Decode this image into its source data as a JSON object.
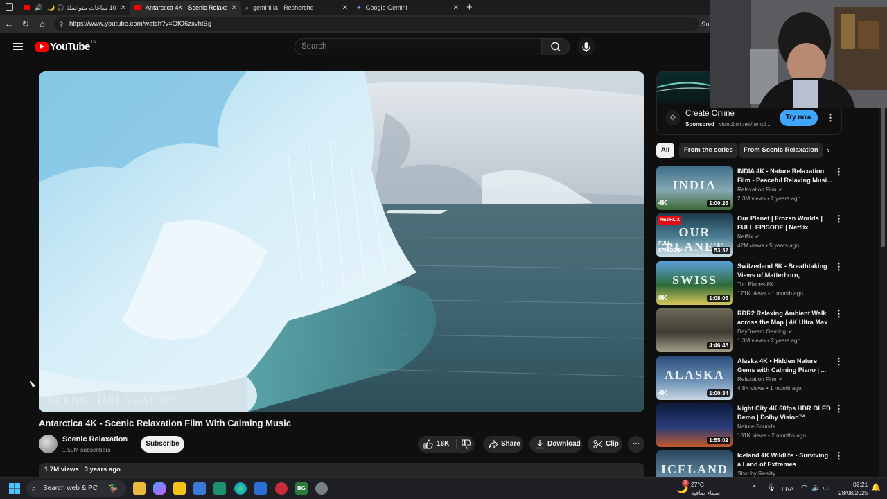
{
  "browser": {
    "tabs": [
      {
        "label": "10 ساعات متواصلة 🎧 🌙 ساعات",
        "active": false
      },
      {
        "label": "Antarctica 4K - Scenic Relaxation",
        "active": true
      },
      {
        "label": "gemini ia - Recherche",
        "active": false
      },
      {
        "label": "Google Gemini",
        "active": false
      }
    ],
    "url": "https://www.youtube.com/watch?v=OfO6zxvhtBg",
    "right_text": "Su"
  },
  "youtube": {
    "logo_text": "YouTube",
    "country_code": "TN",
    "search_placeholder": "Search"
  },
  "video": {
    "watermark": "Scenic Relaxation",
    "title": "Antarctica 4K - Scenic Relaxation Film With Calming Music",
    "channel": "Scenic Relaxation",
    "subscribers": "1.59M subscribers",
    "subscribe_label": "Subscribe",
    "likes": "16K",
    "share_label": "Share",
    "download_label": "Download",
    "clip_label": "Clip",
    "views": "1.7M views",
    "uploaded": "3 years ago"
  },
  "ad": {
    "title": "Create Online",
    "sponsored": "Sponsored",
    "domain": "videobolt.net/templ...",
    "cta": "Try now"
  },
  "chips": [
    "All",
    "From the series",
    "From Scenic Relaxation"
  ],
  "recommendations": [
    {
      "title": "INDIA 4K - Nature Relaxation Film - Peaceful Relaxing Musi...",
      "channel": "Relaxation Film",
      "verified": true,
      "views": "2.3M views",
      "age": "2 years ago",
      "duration": "1:00:26",
      "thumb_text": "INDIA",
      "badge": "4K",
      "colors": [
        "#3f6e8c",
        "#86a9b2",
        "#3d6a34"
      ]
    },
    {
      "title": "Our Planet | Frozen Worlds | FULL EPISODE | Netflix",
      "channel": "Netflix",
      "verified": true,
      "views": "42M views",
      "age": "5 years ago",
      "duration": "53:32",
      "thumb_text": "OUR PLANET",
      "badge": "NETFLIX",
      "corner_text": "FULL EPISODE",
      "colors": [
        "#1c3a4b",
        "#4d7f94",
        "#cfe3ea"
      ]
    },
    {
      "title": "Switzerland 8K - Breathtaking Views of Matterhorn, Jungfrau...",
      "channel": "Top Places 8K",
      "verified": false,
      "views": "171K views",
      "age": "1 month ago",
      "duration": "1:08:05",
      "thumb_text": "SWISS",
      "badge": "8K",
      "colors": [
        "#5aa0d8",
        "#2f6c3a",
        "#d9c75a"
      ]
    },
    {
      "title": "RDR2 Relaxing Ambient Walk across the Map | 4K Ultra Max ...",
      "channel": "DayDream Gaming",
      "verified": true,
      "views": "1.3M views",
      "age": "2 years ago",
      "duration": "4:46:45",
      "thumb_text": "",
      "badge": "",
      "colors": [
        "#6e6a58",
        "#3f3d33",
        "#a39f88"
      ]
    },
    {
      "title": "Alaska 4K • Hidden Nature Gems with Calming Piano | ...",
      "channel": "Relaxation Film",
      "verified": true,
      "views": "4.8K views",
      "age": "1 month ago",
      "duration": "1:00:34",
      "thumb_text": "ALASKA",
      "badge": "4K",
      "colors": [
        "#2c4d7a",
        "#6a8fb3",
        "#c8d7e4"
      ]
    },
    {
      "title": "Night City 4K 60fps HDR OLED Demo | Dolby Vision™",
      "channel": "Nature Sounds",
      "verified": false,
      "views": "181K views",
      "age": "2 months ago",
      "duration": "1:55:02",
      "thumb_text": "",
      "badge": "",
      "colors": [
        "#0d1a3a",
        "#2a3d7a",
        "#c45a2a"
      ]
    },
    {
      "title": "Iceland 4K Wildlife - Surviving a Land of Extremes",
      "channel": "Shot by Reality",
      "verified": false,
      "views": "",
      "age": "",
      "duration": "",
      "thumb_text": "ICELAND",
      "badge": "",
      "colors": [
        "#27465e",
        "#5c8299",
        "#9ab3c0"
      ]
    }
  ],
  "taskbar": {
    "search_label": "Search web & PC",
    "weather_temp": "27°C",
    "weather_desc": "سماء صافية",
    "weather_badge": "3",
    "language": "FRA",
    "time": "02:21",
    "date": "28/08/2025"
  }
}
